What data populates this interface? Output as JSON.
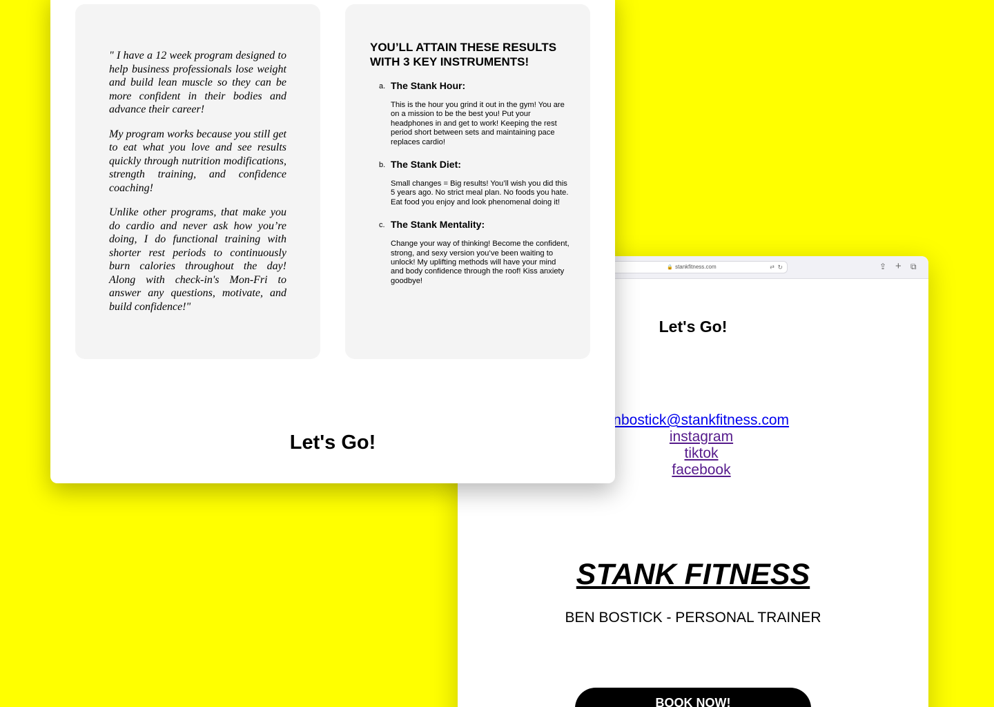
{
  "back_window": {
    "address_bar": {
      "url": "stankfitness.com"
    },
    "title": "Let's Go!",
    "contact": {
      "email": "benbostick@stankfitness.com",
      "links": [
        "instagram",
        "tiktok",
        "facebook"
      ]
    },
    "brand": "STANK FITNESS",
    "subtitle": "BEN BOSTICK - PERSONAL TRAINER",
    "book_button": "BOOK NOW!"
  },
  "front_window": {
    "testimonial": [
      "\" I have a 12 week program designed to help business professionals lose weight and build lean muscle so they can be more confident in their bodies and advance their career!",
      "My program works because you still get to eat what you love and see results quickly through nutrition modifications, strength training, and confidence coaching!",
      "Unlike other programs, that make you do cardio and never ask how you’re doing, I do functional training with shorter rest periods to continuously burn calories throughout the day! Along with check-in's Mon-Fri to answer any questions, motivate, and build confidence!\""
    ],
    "results": {
      "heading": "YOU’LL ATTAIN THESE RESULTS WITH 3 KEY INSTRUMENTS!",
      "items": [
        {
          "marker": "a.",
          "title": "The Stank Hour:",
          "text": "This is the hour you grind it out in the gym! You are on a mission to be the best you! Put your headphones in and get to work! Keeping the rest period short between sets and maintaining pace replaces cardio!"
        },
        {
          "marker": "b.",
          "title": "The Stank Diet:",
          "text": "Small changes = Big results! You’ll wish you did this 5 years ago. No strict meal plan. No foods you hate. Eat food you enjoy and look phenomenal doing it!"
        },
        {
          "marker": "c.",
          "title": "The Stank Mentality:",
          "text": "Change your way of thinking! Become the confident, strong, and sexy version you’ve been waiting to unlock! My uplifting methods will have your mind and body confidence through the roof! Kiss anxiety goodbye!"
        }
      ]
    },
    "title": "Let's Go!"
  },
  "colors": {
    "background": "#ffff00",
    "card": "#f4f4f4",
    "link": "#0000ee",
    "visited_link": "#551a8b",
    "button": "#000000"
  }
}
